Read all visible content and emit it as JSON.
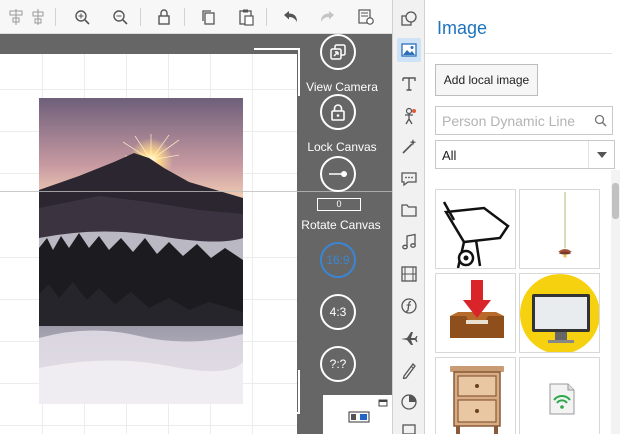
{
  "toolbar": {
    "buttons": [
      {
        "name": "align-icon"
      },
      {
        "name": "distribute-icon"
      },
      {
        "name": "zoom-in-icon"
      },
      {
        "name": "zoom-out-icon"
      },
      {
        "name": "lock-icon"
      },
      {
        "name": "copy-icon"
      },
      {
        "name": "paste-icon"
      },
      {
        "name": "undo-icon"
      },
      {
        "name": "redo-icon"
      },
      {
        "name": "properties-icon"
      }
    ]
  },
  "camera": {
    "view_camera_label": "View Camera",
    "lock_canvas_label": "Lock Canvas",
    "rotate_canvas_label": "Rotate Canvas",
    "rotate_value": "0",
    "ratio_16_9": "16:9",
    "ratio_4_3": "4:3",
    "ratio_custom": "?:?",
    "active_ratio": "16:9",
    "accent": "#3a86d6"
  },
  "sidebar_tools": [
    {
      "name": "shapes-icon"
    },
    {
      "name": "image-icon",
      "selected": true
    },
    {
      "name": "text-icon"
    },
    {
      "name": "character-icon"
    },
    {
      "name": "effects-wand-icon"
    },
    {
      "name": "speech-bubble-icon"
    },
    {
      "name": "folder-icon"
    },
    {
      "name": "music-icon"
    },
    {
      "name": "video-icon"
    },
    {
      "name": "formula-icon"
    },
    {
      "name": "airplane-icon"
    },
    {
      "name": "pen-hand-icon"
    },
    {
      "name": "pie-chart-icon"
    },
    {
      "name": "more-icon"
    }
  ],
  "panel": {
    "title": "Image",
    "add_button": "Add local image",
    "search_placeholder": "Person Dynamic Line",
    "filter_value": "All",
    "title_color": "#1e73be",
    "images": [
      {
        "name": "wheelbarrow-image"
      },
      {
        "name": "pendulum-lamp-image"
      },
      {
        "name": "download-tray-image"
      },
      {
        "name": "monitor-image"
      },
      {
        "name": "nightstand-image"
      },
      {
        "name": "wifi-document-image"
      }
    ]
  }
}
